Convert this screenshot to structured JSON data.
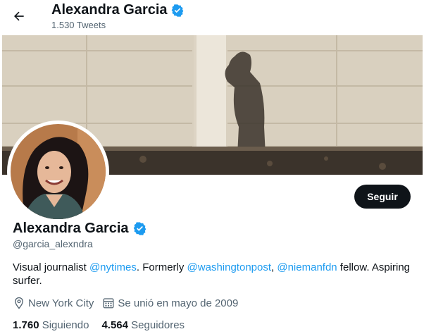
{
  "header": {
    "name": "Alexandra Garcia",
    "tweet_count": "1.530 Tweets",
    "back_icon": "arrow-left-icon",
    "verified_icon": "verified-badge-icon"
  },
  "banner": {
    "description_icon": "banner-image"
  },
  "actions": {
    "follow_label": "Seguir"
  },
  "profile": {
    "name": "Alexandra Garcia",
    "handle": "@garcia_alexndra",
    "bio": {
      "part1": "Visual journalist ",
      "link1": "@nytimes",
      "part2": ". Formerly ",
      "link2": "@washingtonpost",
      "part3": ", ",
      "link3": "@niemanfdn",
      "part4": " fellow. Aspiring surfer."
    },
    "location": "New York City",
    "joined": "Se unió en mayo de 2009"
  },
  "stats": {
    "following_count": "1.760",
    "following_label": "Siguiendo",
    "followers_count": "4.564",
    "followers_label": "Seguidores"
  },
  "colors": {
    "accent": "#1d9bf0",
    "text_primary": "#0f1419",
    "text_secondary": "#536471",
    "button_bg": "#0f1419"
  }
}
